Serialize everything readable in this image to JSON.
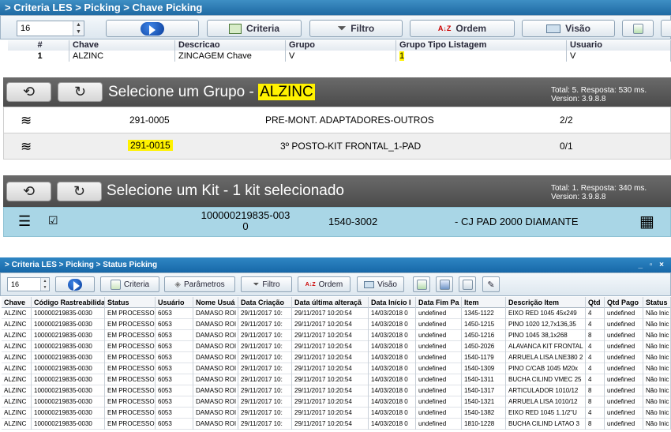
{
  "panel1": {
    "breadcrumb": "> Criteria LES > Picking > Chave Picking",
    "page_size": "16",
    "buttons": {
      "criteria": "Criteria",
      "filtro": "Filtro",
      "ordem": "Ordem",
      "visao": "Visão"
    },
    "columns": [
      "#",
      "Chave",
      "Descricao",
      "Grupo",
      "Grupo Tipo Listagem",
      "Usuario"
    ],
    "row": [
      "1",
      "ALZINC",
      "ZINCAGEM Chave",
      "V",
      "1",
      "V"
    ]
  },
  "panel2": {
    "title_prefix": "Selecione um Grupo - ",
    "title_highlight": "ALZINC",
    "info_total": "Total: 5. Resposta: 530 ms.",
    "info_version": "Version: 3.9.8.8",
    "rows": [
      {
        "code": "291-0005",
        "description": "PRE-MONT. ADAPTADORES-OUTROS",
        "count": "2/2"
      },
      {
        "code": "291-0015",
        "description": "3º POSTO-KIT FRONTAL_1-PAD",
        "count": "0/1"
      }
    ]
  },
  "panel3": {
    "title": "Selecione um Kit - 1 kit selecionado",
    "info_total": "Total: 1. Resposta: 340 ms.",
    "info_version": "Version: 3.9.8.8",
    "kit": {
      "code_line1": "100000219835-003",
      "code_line2": "0",
      "item": "1540-3002",
      "description": "- CJ PAD 2000 DIAMANTE"
    }
  },
  "panel4": {
    "breadcrumb": "> Criteria LES > Picking > Status Picking",
    "window_controls": "_ ▫ ×",
    "page_size": "16",
    "buttons": {
      "criteria": "Criteria",
      "parametros": "Parâmetros",
      "filtro": "Filtro",
      "ordem": "Ordem",
      "visao": "Visão"
    },
    "columns": [
      "Chave",
      "Código Rastreabilida",
      "Status",
      "Usuário",
      "Nome Usuá",
      "Data Criação",
      "Data última alteraçã",
      "Data Início I",
      "Data Fim Pa",
      "Item",
      "Descrição Item",
      "Qtd",
      "Qtd Pago",
      "Status"
    ],
    "rows": [
      [
        "ALZINC",
        "100000219835-0030",
        "EM PROCESSO",
        "6053",
        "DAMASO ROI",
        "29/11/2017 10:",
        "29/11/2017 10:20:54",
        "14/03/2018 0",
        "undefined",
        "1345-1122",
        "EIXO RED 1045 45x249",
        "4",
        "undefined",
        "Não Inic"
      ],
      [
        "ALZINC",
        "100000219835-0030",
        "EM PROCESSO",
        "6053",
        "DAMASO ROI",
        "29/11/2017 10:",
        "29/11/2017 10:20:54",
        "14/03/2018 0",
        "undefined",
        "1450-1215",
        "PINO 1020 12,7x136,35",
        "4",
        "undefined",
        "Não Inic"
      ],
      [
        "ALZINC",
        "100000219835-0030",
        "EM PROCESSO",
        "6053",
        "DAMASO ROI",
        "29/11/2017 10:",
        "29/11/2017 10:20:54",
        "14/03/2018 0",
        "undefined",
        "1450-1216",
        "PINO 1045 38,1x268",
        "8",
        "undefined",
        "Não Inic"
      ],
      [
        "ALZINC",
        "100000219835-0030",
        "EM PROCESSO",
        "6053",
        "DAMASO ROI",
        "29/11/2017 10:",
        "29/11/2017 10:20:54",
        "14/03/2018 0",
        "undefined",
        "1450-2026",
        "ALAVANCA KIT FRONTAL",
        "4",
        "undefined",
        "Não Inic"
      ],
      [
        "ALZINC",
        "100000219835-0030",
        "EM PROCESSO",
        "6053",
        "DAMASO ROI",
        "29/11/2017 10:",
        "29/11/2017 10:20:54",
        "14/03/2018 0",
        "undefined",
        "1540-1179",
        "ARRUELA LISA LNE380 2",
        "4",
        "undefined",
        "Não Inic"
      ],
      [
        "ALZINC",
        "100000219835-0030",
        "EM PROCESSO",
        "6053",
        "DAMASO ROI",
        "29/11/2017 10:",
        "29/11/2017 10:20:54",
        "14/03/2018 0",
        "undefined",
        "1540-1309",
        "PINO C/CAB 1045 M20x",
        "4",
        "undefined",
        "Não Inic"
      ],
      [
        "ALZINC",
        "100000219835-0030",
        "EM PROCESSO",
        "6053",
        "DAMASO ROI",
        "29/11/2017 10:",
        "29/11/2017 10:20:54",
        "14/03/2018 0",
        "undefined",
        "1540-1311",
        "BUCHA CILIND VMEC 25",
        "4",
        "undefined",
        "Não Inic"
      ],
      [
        "ALZINC",
        "100000219835-0030",
        "EM PROCESSO",
        "6053",
        "DAMASO ROI",
        "29/11/2017 10:",
        "29/11/2017 10:20:54",
        "14/03/2018 0",
        "undefined",
        "1540-1317",
        "ARTICULADOR 1010/12",
        "8",
        "undefined",
        "Não Inic"
      ],
      [
        "ALZINC",
        "100000219835-0030",
        "EM PROCESSO",
        "6053",
        "DAMASO ROI",
        "29/11/2017 10:",
        "29/11/2017 10:20:54",
        "14/03/2018 0",
        "undefined",
        "1540-1321",
        "ARRUELA LISA 1010/12",
        "8",
        "undefined",
        "Não Inic"
      ],
      [
        "ALZINC",
        "100000219835-0030",
        "EM PROCESSO",
        "6053",
        "DAMASO ROI",
        "29/11/2017 10:",
        "29/11/2017 10:20:54",
        "14/03/2018 0",
        "undefined",
        "1540-1382",
        "EIXO RED 1045 1.1/2\"U",
        "4",
        "undefined",
        "Não Inic"
      ],
      [
        "ALZINC",
        "100000219835-0030",
        "EM PROCESSO",
        "6053",
        "DAMASO ROI",
        "29/11/2017 10:",
        "29/11/2017 10:20:54",
        "14/03/2018 0",
        "undefined",
        "1810-1228",
        "BUCHA CILIND LATAO 3",
        "8",
        "undefined",
        "Não Inic"
      ]
    ]
  },
  "colors": {
    "header_blue": "#1f6aa3",
    "tablet_gray": "#555555",
    "highlight": "#fff200",
    "selected_row": "#a9d6e6"
  },
  "icons": [
    "undo-icon",
    "refresh-icon",
    "layers-icon",
    "list-icon",
    "checkbox-icon",
    "boxes-icon",
    "funnel-icon",
    "sort-az-icon",
    "play-icon"
  ]
}
